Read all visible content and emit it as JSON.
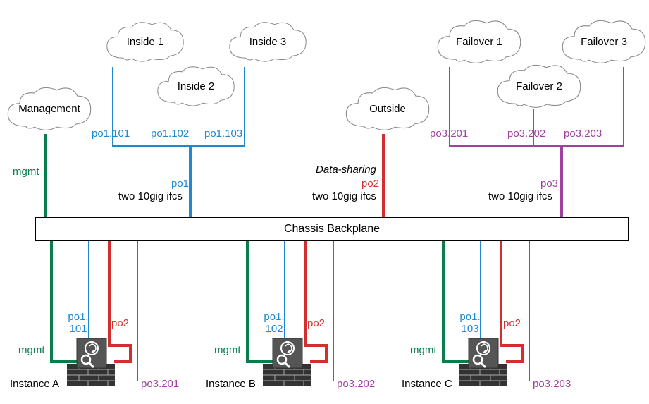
{
  "clouds": {
    "management": "Management",
    "inside1": "Inside 1",
    "inside2": "Inside 2",
    "inside3": "Inside 3",
    "outside": "Outside",
    "failover1": "Failover 1",
    "failover2": "Failover 2",
    "failover3": "Failover 3"
  },
  "chassis": "Chassis Backplane",
  "top": {
    "mgmt": "mgmt",
    "po1_101": "po1.101",
    "po1_102": "po1.102",
    "po1_103": "po1.103",
    "po1": "po1",
    "po1_desc": "two 10gig ifcs",
    "datasharing": "Data-sharing",
    "po2": "po2",
    "po2_desc": "two 10gig ifcs",
    "po3_201": "po3.201",
    "po3_202": "po3.202",
    "po3_203": "po3.203",
    "po3": "po3",
    "po3_desc": "two 10gig ifcs"
  },
  "inst": {
    "a": {
      "name": "Instance A",
      "mgmt": "mgmt",
      "po1": "po1.\n101",
      "po2": "po2",
      "po3": "po3.201"
    },
    "b": {
      "name": "Instance B",
      "mgmt": "mgmt",
      "po1": "po1.\n102",
      "po2": "po2",
      "po3": "po3.202"
    },
    "c": {
      "name": "Instance C",
      "mgmt": "mgmt",
      "po1": "po1.\n103",
      "po2": "po2",
      "po3": "po3.203"
    }
  }
}
